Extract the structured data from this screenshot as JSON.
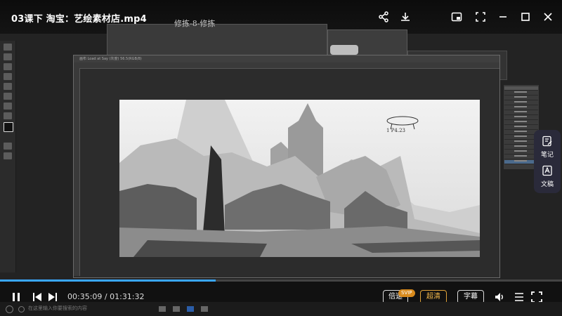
{
  "header": {
    "title": "03课下 淘宝：艺绘素材店.mp4",
    "icons": [
      "share-icon",
      "download-icon",
      "pip-icon",
      "fullscreen-window-icon",
      "minimize-icon",
      "maximize-icon",
      "close-icon"
    ]
  },
  "desktop": {
    "background_window_title": "修拣-8-修拣",
    "main_window_label": "画布 Load at Say (灰度) 56.5(RGB/8)",
    "canvas_sketch_note": "1 P4.23"
  },
  "side_tools": {
    "notes_label": "笔记",
    "script_label": "文稿"
  },
  "player": {
    "current_time": "00:35:09",
    "separator": " / ",
    "total_time": "01:31:32",
    "progress_fraction": 0.384,
    "speed_label": "倍速",
    "quality_label": "超清",
    "quality_badge": "SVIP",
    "subtitle_label": "字幕",
    "accent_color": "#3aa7ff",
    "badge_color": "#d88a1c"
  },
  "taskbar": {
    "search_placeholder": "在这里输入你要搜索的内容"
  }
}
